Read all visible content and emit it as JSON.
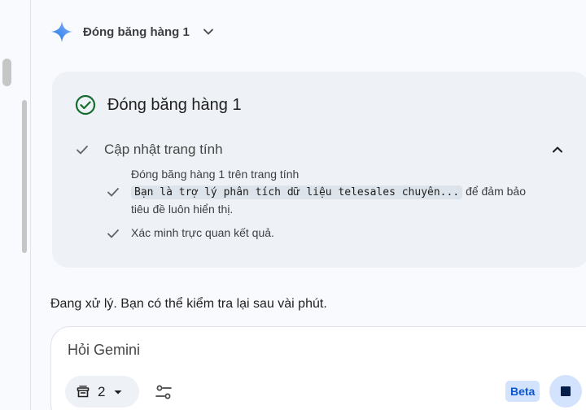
{
  "header": {
    "title": "Đóng băng hàng 1",
    "icon": "gemini-spark-icon"
  },
  "task": {
    "title": "Đóng băng hàng 1",
    "step": {
      "label": "Cập nhật trang tính",
      "substeps": [
        {
          "line1": "Đóng băng hàng 1 trên trang tính",
          "code": "Bạn là trợ lý phân tích dữ liệu telesales chuyên...",
          "line2_after": "để đảm bảo",
          "line3": "tiêu đề luôn hiển thị."
        },
        {
          "text": "Xác minh trực quan kết quả."
        }
      ]
    }
  },
  "status_message": "Đang xử lý. Bạn có thể kiểm tra lại sau vài phút.",
  "input": {
    "placeholder": "Hỏi Gemini",
    "count": "2",
    "beta_label": "Beta"
  },
  "colors": {
    "success_green": "#146c2e",
    "accent_blue": "#0b57d0",
    "card_bg": "#eef2f7"
  }
}
